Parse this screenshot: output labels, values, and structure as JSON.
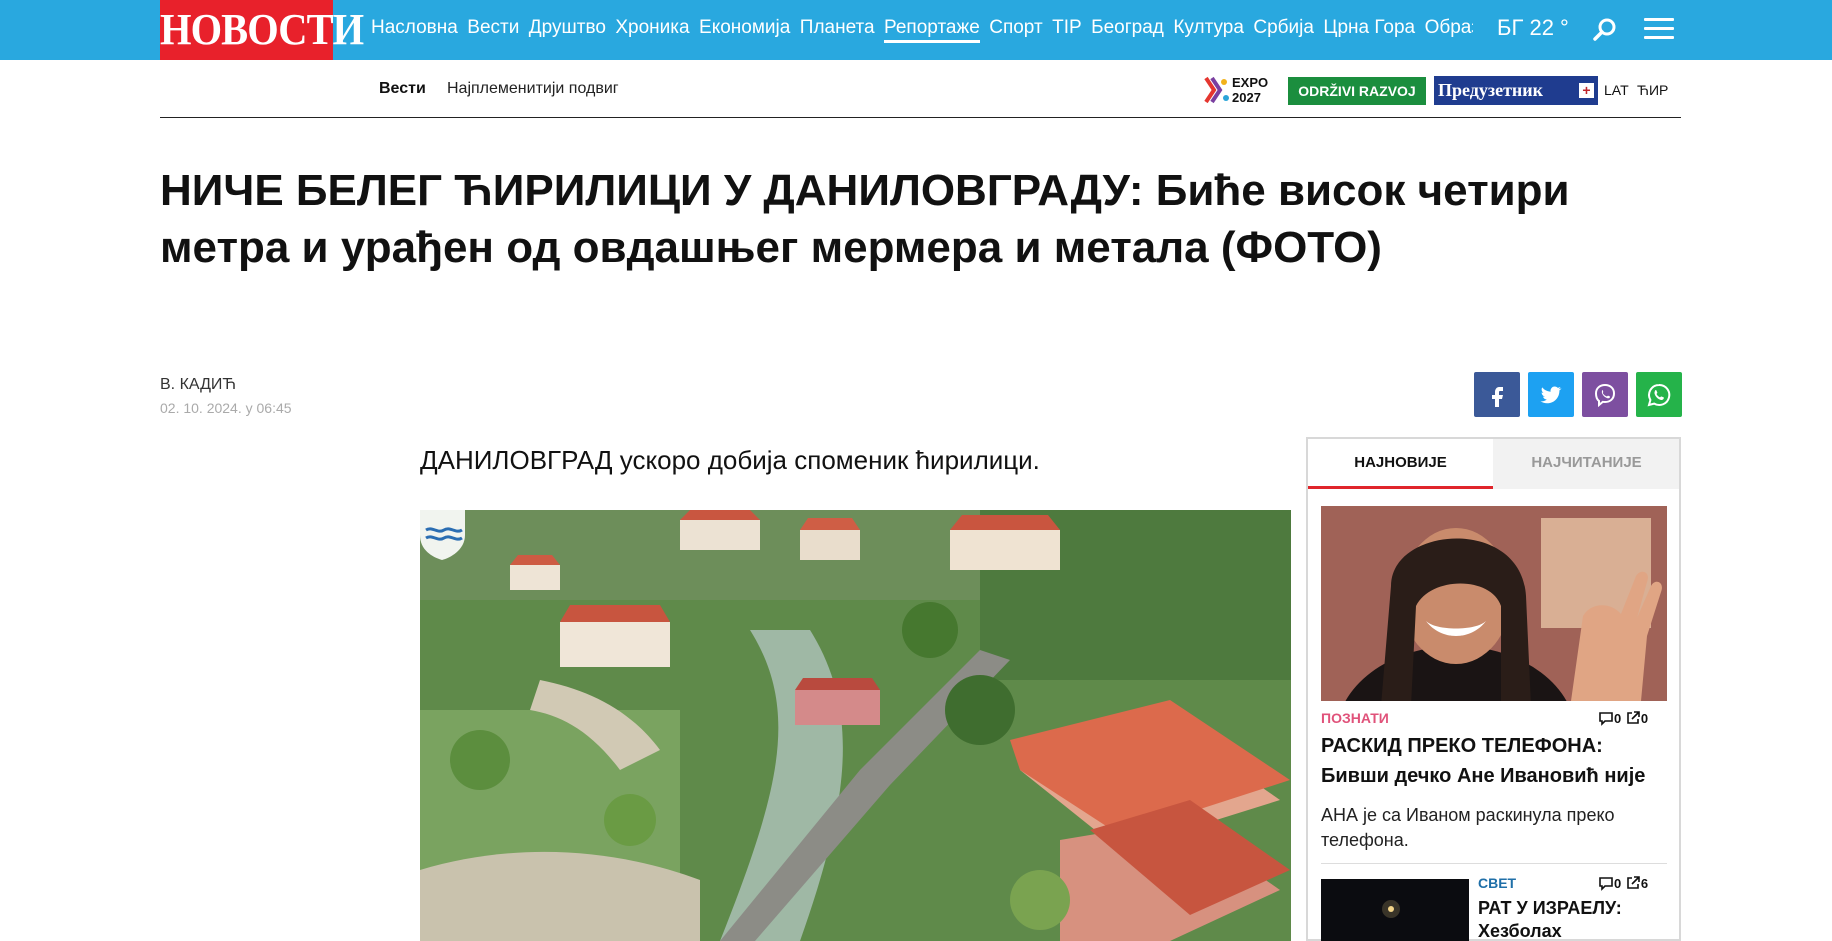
{
  "header": {
    "logo": "НОВОСТИ",
    "nav": [
      "Насловна",
      "Вести",
      "Друштво",
      "Хроника",
      "Економија",
      "Планета",
      "Репортаже",
      "Спорт",
      "TIP",
      "Београд",
      "Култура",
      "Србија",
      "Црна Гора",
      "Образ"
    ],
    "active_nav": "Репортаже",
    "weather": "БГ 22 °"
  },
  "subheader": {
    "section": "Вести",
    "tag": "Најплеменитији подвиг",
    "expo_label": "EXPO 2027",
    "odrzivi_label": "ODRŽIVI RAZVOJ",
    "preduzetnik_label": "Предузетник",
    "preduzetnik_plus": "+",
    "lang_lat": "LAT",
    "lang_cyr": "ЋИР"
  },
  "article": {
    "title": "НИЧЕ БЕЛЕГ ЋИРИЛИЦИ У ДАНИЛОВГРАДУ: Биће висок четири метра и урађен од овдашњег мермера и метала (ФОТО)",
    "author": "В. КАДИЋ",
    "date": "02. 10. 2024. у 06:45",
    "lead": "ДАНИЛОВГРАД ускоро добија споменик ћирилици."
  },
  "share": {
    "facebook_color": "#3b5998",
    "twitter_color": "#1da1f2",
    "viber_color": "#7d4fa0",
    "whatsapp_color": "#25b34a"
  },
  "sidebar": {
    "tabs": [
      "НАЈНОВИЈЕ",
      "НАЈЧИТАНИЈЕ"
    ],
    "item1": {
      "category": "ПОЗНАТИ",
      "comments": "0",
      "shares": "0",
      "title": "РАСКИД ПРЕКО ТЕЛЕФОНА: Бивши дечко Ане Ивановић није",
      "lead": "АНА је са Иваном раскинула преко телефона."
    },
    "item2": {
      "category": "СВЕТ",
      "comments": "0",
      "shares": "6",
      "title": "РАТ У ИЗРАЕЛУ: Хезболах"
    }
  },
  "colors": {
    "topbar": "#29a8df",
    "logo_bg": "#e8212b",
    "accent_red": "#e0252b",
    "category_pink": "#e0527a",
    "category_blue": "#1f6fa8"
  }
}
